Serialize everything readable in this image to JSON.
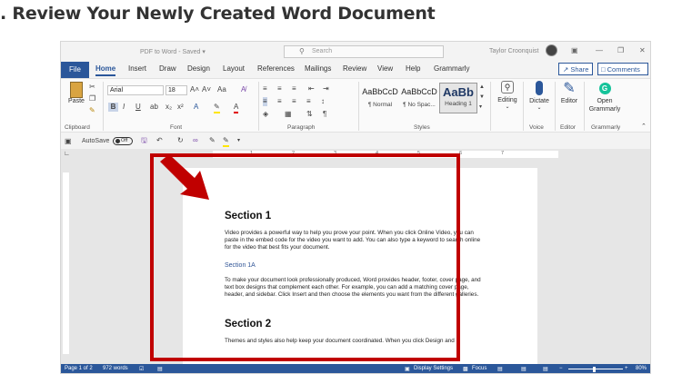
{
  "page_heading": ". Review Your Newly Created Word Document",
  "titlebar": {
    "doc_title": "PDF to Word - Saved ▾",
    "search_placeholder": "Search",
    "user_name": "Taylor Croonquist",
    "controls": [
      "▣",
      "—",
      "❐",
      "✕"
    ]
  },
  "tabs": {
    "file": "File",
    "items": [
      "Home",
      "Insert",
      "Draw",
      "Design",
      "Layout",
      "References",
      "Mailings",
      "Review",
      "View",
      "Help",
      "Grammarly"
    ],
    "active": "Home",
    "share": "Share",
    "comments": "Comments"
  },
  "ribbon": {
    "clipboard": {
      "paste": "Paste",
      "label": "Clipboard"
    },
    "font": {
      "name": "Arial",
      "size": "18",
      "label": "Font",
      "bold": "B",
      "italic": "I",
      "underline": "U",
      "font_color_letter": "A",
      "increase": "A˄",
      "decrease": "A˅",
      "case": "Aa",
      "clear": "A̸"
    },
    "paragraph": {
      "label": "Paragraph",
      "pilcrow": "¶"
    },
    "styles": {
      "label": "Styles",
      "items": [
        {
          "preview": "AaBbCcD",
          "name": "¶ Normal"
        },
        {
          "preview": "AaBbCcD",
          "name": "¶ No Spac..."
        },
        {
          "preview": "AaBb",
          "name": "Heading 1"
        }
      ]
    },
    "editing": {
      "label": "Editing"
    },
    "voice": {
      "dictate": "Dictate",
      "label": "Voice"
    },
    "editor": {
      "button": "Editor",
      "label": "Editor"
    },
    "grammarly": {
      "button": "Open Grammarly",
      "label": "Grammarly"
    }
  },
  "qat": {
    "autosave": "AutoSave",
    "toggle_state": "Off"
  },
  "ruler": {
    "numbers": [
      "1",
      "2",
      "3",
      "4",
      "5",
      "6",
      "7"
    ]
  },
  "document": {
    "section1_title": "Section 1",
    "section1_body": "Video provides a powerful way to help you prove your point. When you click Online Video, you can paste in the embed code for the video you want to add. You can also type a keyword to search online for the video that best fits your document.",
    "section1a_title": "Section 1A",
    "section1a_body": "To make your document look professionally produced, Word provides header, footer, cover page, and text box designs that complement each other. For example, you can add a matching cover page, header, and sidebar. Click Insert and then choose the elements you want from the different galleries.",
    "section2_title": "Section 2",
    "section2_body": "Themes and styles also help keep your document coordinated. When you click Design and"
  },
  "statusbar": {
    "page": "Page 1 of 2",
    "words": "972 words",
    "display_settings": "Display Settings",
    "focus": "Focus",
    "zoom": "80%"
  },
  "colors": {
    "word_blue": "#2b579a",
    "highlight_red": "#c00000",
    "heading2_blue": "#2f5496"
  }
}
